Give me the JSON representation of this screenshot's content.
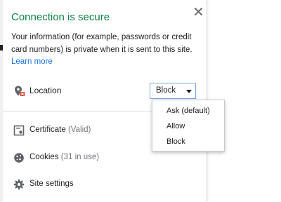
{
  "popup": {
    "title": "Connection is secure",
    "description": "Your information (for example, passwords or credit card numbers) is private when it is sent to this site.",
    "learn_more": "Learn more",
    "close_icon": "close-icon",
    "colors": {
      "title_green": "#0b8043",
      "link_blue": "#1a73e8"
    }
  },
  "permission": {
    "label": "Location",
    "icon": "location-blocked-icon",
    "selected": "Block",
    "options": [
      "Ask (default)",
      "Allow",
      "Block"
    ]
  },
  "rows": [
    {
      "label": "Certificate",
      "sub": " (Valid)",
      "icon": "certificate-icon"
    },
    {
      "label": "Cookies",
      "sub": " (31 in use)",
      "icon": "cookie-icon"
    },
    {
      "label": "Site settings",
      "sub": "",
      "icon": "gear-icon"
    }
  ]
}
